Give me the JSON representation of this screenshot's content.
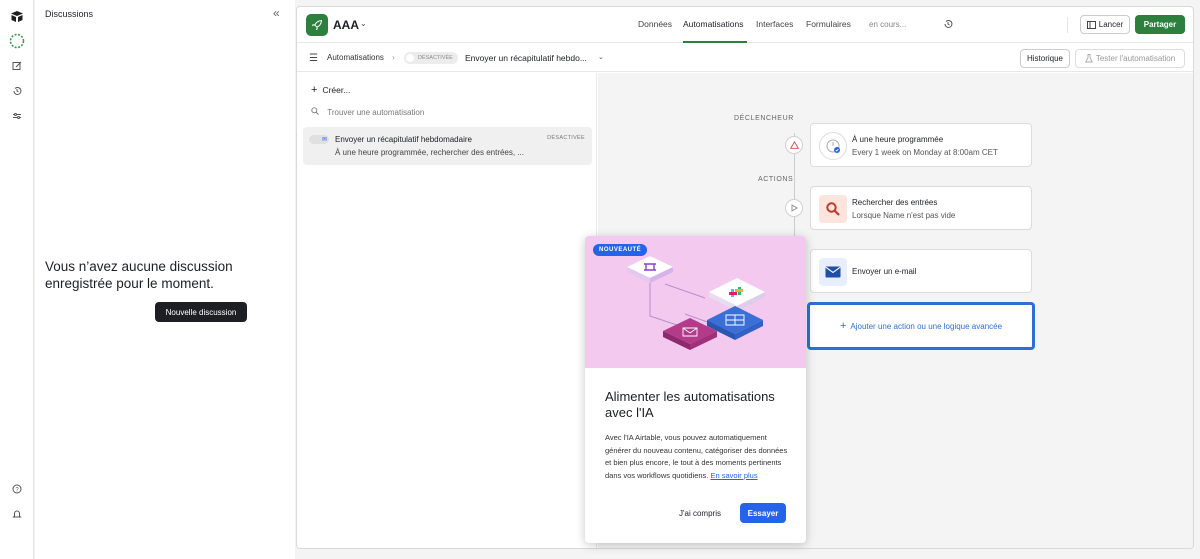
{
  "sidebar": {
    "icons": [
      "airtable-logo-icon",
      "omni-ai-icon",
      "compose-icon",
      "history-icon",
      "sliders-icon",
      "help-icon",
      "bell-icon"
    ]
  },
  "chat_panel": {
    "title": "Discussions",
    "collapse_icon": "«",
    "empty_message": "Vous n’avez aucune discussion enregistrée pour le moment.",
    "new_button": "Nouvelle discussion"
  },
  "topbar": {
    "app_name": "AAA",
    "app_chevron": "⌄",
    "nav_tabs": [
      {
        "label": "Données",
        "active": false
      },
      {
        "label": "Automatisations",
        "active": true
      },
      {
        "label": "Interfaces",
        "active": false
      },
      {
        "label": "Formulaires",
        "active": false
      }
    ],
    "status_text": "en cours...",
    "launch_button": "Lancer",
    "share_button": "Partager",
    "accent_color": "#2d7f3e"
  },
  "subbar": {
    "crumb": "Automatisations",
    "crumb_sep": "›",
    "status_pill": "DÉSACTIVÉE",
    "automation_name": "Envoyer un récapitulatif hebdo...",
    "automation_chevron": "⌄",
    "history_button": "Historique",
    "test_button": "Tester l'automatisation"
  },
  "left_list": {
    "create_label": "Créer...",
    "search_placeholder": "Trouver une automatisation",
    "items": [
      {
        "name": "Envoyer un récapitulatif hebdomadaire",
        "description": "À une heure programmée, rechercher des entrées, ...",
        "status": "DÉSACTIVÉE"
      }
    ]
  },
  "canvas": {
    "trigger_label": "DÉCLENCHEUR",
    "actions_label": "ACTIONS",
    "trigger": {
      "title": "À une heure programmée",
      "subtitle": "Every 1 week on Monday at 8:00am CET"
    },
    "actions": [
      {
        "title": "Rechercher des entrées",
        "subtitle": "Lorsque Name n'est pas vide",
        "icon": "search-icon"
      },
      {
        "title": "Envoyer un e-mail",
        "subtitle": "",
        "icon": "mail-icon"
      }
    ],
    "add_action": "Ajouter une action ou une logique avancée"
  },
  "popup": {
    "badge": "NOUVEAUTÉ",
    "title": "Alimenter les automatisations avec l'IA",
    "body": "Avec l'IA Airtable, vous pouvez automatiquement générer du nouveau contenu, catégoriser des données et bien plus encore, le tout à des moments pertinents dans vos workflows quotidiens.",
    "link": "En savoir plus",
    "dismiss_button": "J'ai compris",
    "try_button": "Essayer"
  }
}
